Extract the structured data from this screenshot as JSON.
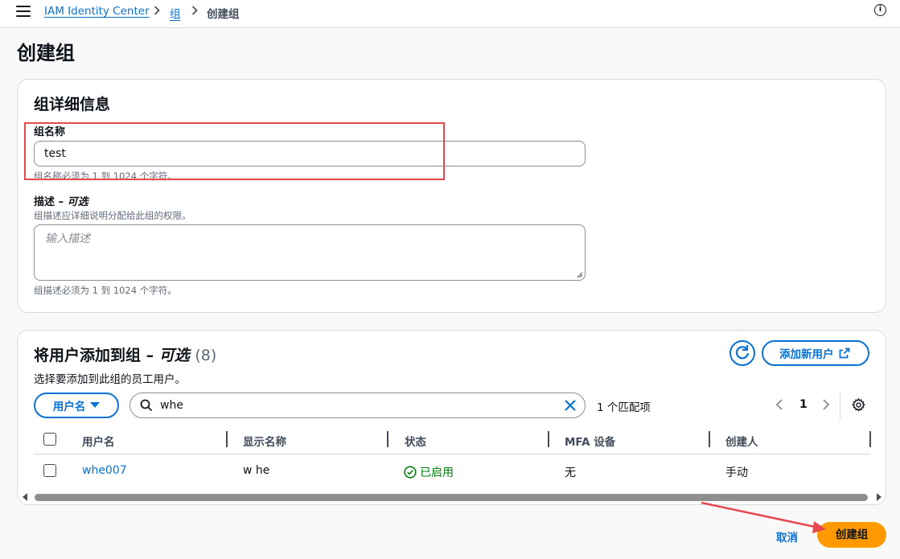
{
  "breadcrumb": {
    "items": [
      "IAM Identity Center",
      "组"
    ],
    "current": "创建组"
  },
  "page": {
    "title": "创建组"
  },
  "group_details": {
    "heading": "组详细信息",
    "name_label": "组名称",
    "name_value": "test",
    "name_hint": "组名称必须为 1 到 1024 个字符。",
    "desc_label": "描述 – ",
    "desc_label_optional": "可选",
    "desc_hint_top": "组描述应详细说明分配给此组的权限。",
    "desc_placeholder": "输入描述",
    "desc_hint_bottom": "组描述必须为 1 到 1024 个字符。"
  },
  "add_users": {
    "heading": "将用户添加到组 – ",
    "heading_optional": "可选",
    "count": "(8)",
    "subtitle": "选择要添加到此组的员工用户。",
    "refresh_icon": "refresh-icon",
    "add_new_user_label": "添加新用户",
    "filter_property": "用户名",
    "search_value": "whe",
    "match_count": "1 个匹配项",
    "page_number": "1",
    "columns": [
      "用户名",
      "显示名称",
      "状态",
      "MFA 设备",
      "创建人"
    ],
    "rows": [
      {
        "username": "whe007",
        "display_name": "w he",
        "status": "已启用",
        "mfa": "无",
        "created_by": "手动"
      }
    ]
  },
  "footer": {
    "cancel_label": "取消",
    "create_label": "创建组"
  },
  "colors": {
    "link": "#0972d3",
    "primary": "#ff9900",
    "success": "#037f0c",
    "annotation": "#e5484d"
  }
}
